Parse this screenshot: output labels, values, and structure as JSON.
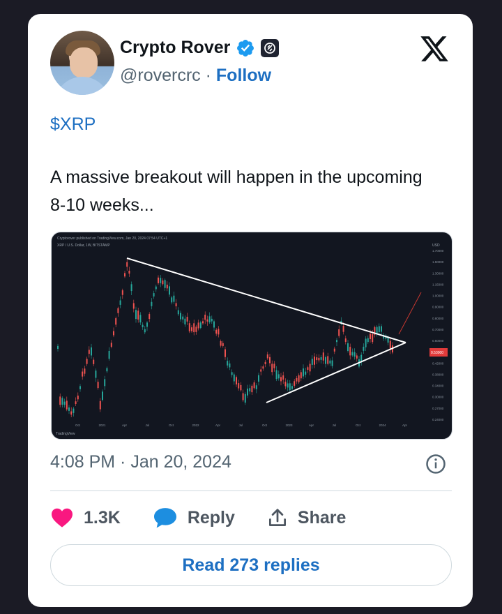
{
  "author": {
    "name": "Crypto Rover",
    "handle": "@rovercrc",
    "separator": "·",
    "follow_label": "Follow"
  },
  "tweet": {
    "cashtag": "$XRP",
    "text": "A massive breakout will happen in the upcoming 8-10 weeks...",
    "timestamp": "4:08 PM · Jan 20, 2024"
  },
  "chart_image": {
    "header": "Cryptorover published on TradingView.com, Jan 20, 2024 07:54 UTC+1",
    "symbol_line": "XRP / U.S. Dollar, 1W, BITSTAMP",
    "currency": "USD",
    "price_ticks": [
      "1.70000",
      "1.50000",
      "1.30000",
      "1.15000",
      "1.00000",
      "0.90000",
      "0.80000",
      "0.70000",
      "0.60000",
      "0.48000",
      "0.42000",
      "0.38000",
      "0.34000",
      "0.30000",
      "0.27000",
      "0.24000"
    ],
    "price_tag": "0.53000",
    "time_ticks": [
      "Oct",
      "2021",
      "Apr",
      "Jul",
      "Oct",
      "2022",
      "Apr",
      "Jul",
      "Oct",
      "2023",
      "Apr",
      "Jul",
      "Oct",
      "2024",
      "Apr"
    ],
    "watermark": "TradingView"
  },
  "actions": {
    "likes": "1.3K",
    "reply_label": "Reply",
    "share_label": "Share"
  },
  "read_replies_label": "Read 273 replies",
  "colors": {
    "accent": "#1d6fc2",
    "like": "#f91880",
    "text_primary": "#0f1419",
    "text_secondary": "#536471",
    "candle_up": "#26a69a",
    "candle_down": "#ef5350"
  }
}
